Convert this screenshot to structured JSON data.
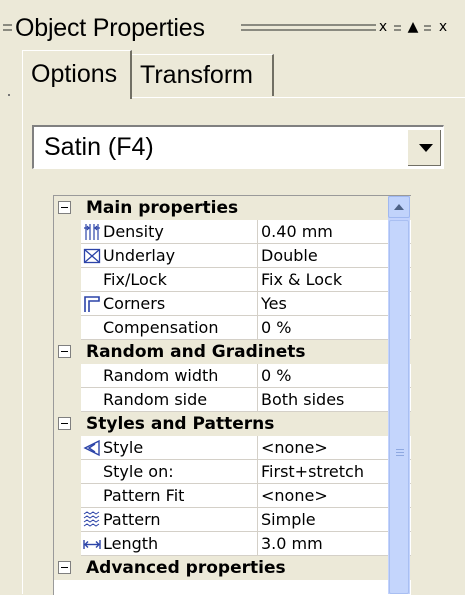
{
  "panel": {
    "title": "Object Properties",
    "buttons": [
      "x",
      "▲",
      "x"
    ]
  },
  "tabs": [
    {
      "label": "Options",
      "active": true
    },
    {
      "label": "Transform",
      "active": false
    }
  ],
  "stitch_type": {
    "value": "Satin (F4)"
  },
  "categories": [
    {
      "label": "Main properties",
      "rows": [
        {
          "name": "Density",
          "value": "0.40 mm",
          "icon": "density-icon"
        },
        {
          "name": "Underlay",
          "value": "Double",
          "icon": "underlay-icon"
        },
        {
          "name": "Fix/Lock",
          "value": "Fix & Lock",
          "icon": null
        },
        {
          "name": "Corners",
          "value": "Yes",
          "icon": "corners-icon"
        },
        {
          "name": "Compensation",
          "value": "0 %",
          "icon": null
        }
      ]
    },
    {
      "label": "Random and Gradinets",
      "rows": [
        {
          "name": "Random width",
          "value": "0 %",
          "icon": null
        },
        {
          "name": "Random side",
          "value": "Both sides",
          "icon": null
        }
      ]
    },
    {
      "label": "Styles and Patterns",
      "rows": [
        {
          "name": "Style",
          "value": "<none>",
          "icon": "style-icon"
        },
        {
          "name": "Style on:",
          "value": "First+stretch",
          "icon": null
        },
        {
          "name": "Pattern Fit",
          "value": "<none>",
          "icon": null
        },
        {
          "name": "Pattern",
          "value": "Simple",
          "icon": "pattern-icon"
        },
        {
          "name": "Length",
          "value": "3.0 mm",
          "icon": "length-icon"
        }
      ]
    },
    {
      "label": "Advanced properties",
      "rows": []
    }
  ],
  "colors": {
    "panel_bg": "#ece9d8",
    "scrollbar": "#c3d3fd",
    "icon_blue": "#2c44a8"
  }
}
